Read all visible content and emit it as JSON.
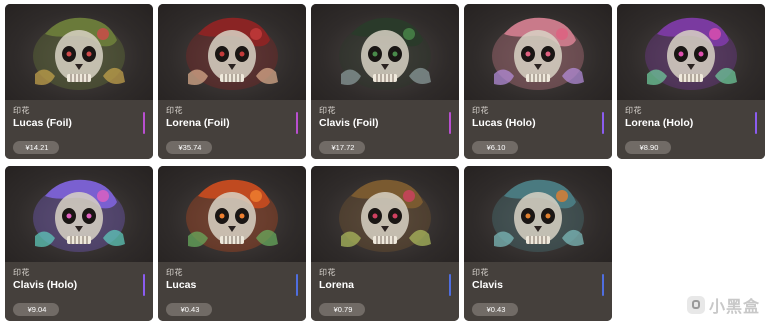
{
  "cards": [
    {
      "type": "印花",
      "name": "Lucas (Foil)",
      "price": "¥14.21",
      "rarity_color": "#b94fd0",
      "art": {
        "base": "#6a7a3a",
        "accent": "#d04a4a",
        "glow": "#c9a64d"
      }
    },
    {
      "type": "印花",
      "name": "Lorena (Foil)",
      "price": "¥35.74",
      "rarity_color": "#b94fd0",
      "art": {
        "base": "#8a2424",
        "accent": "#c43b3b",
        "glow": "#e0b090"
      }
    },
    {
      "type": "印花",
      "name": "Clavis (Foil)",
      "price": "¥17.72",
      "rarity_color": "#b94fd0",
      "art": {
        "base": "#2a3a2a",
        "accent": "#4a8a4a",
        "glow": "#8fa0a0"
      }
    },
    {
      "type": "印花",
      "name": "Lucas (Holo)",
      "price": "¥6.10",
      "rarity_color": "#8b5cf0",
      "art": {
        "base": "#c97a8a",
        "accent": "#e06080",
        "glow": "#b890e0"
      }
    },
    {
      "type": "印花",
      "name": "Lorena (Holo)",
      "price": "¥8.90",
      "rarity_color": "#8b5cf0",
      "art": {
        "base": "#7a3aa0",
        "accent": "#e050b0",
        "glow": "#70d0a0"
      }
    },
    {
      "type": "印花",
      "name": "Clavis (Holo)",
      "price": "¥9.04",
      "rarity_color": "#8b5cf0",
      "art": {
        "base": "#7a60d0",
        "accent": "#e060c0",
        "glow": "#60d0c0"
      }
    },
    {
      "type": "印花",
      "name": "Lucas",
      "price": "¥0.43",
      "rarity_color": "#4f6ee0",
      "art": {
        "base": "#c04a20",
        "accent": "#f08030",
        "glow": "#6ab060"
      }
    },
    {
      "type": "印花",
      "name": "Lorena",
      "price": "¥0.79",
      "rarity_color": "#4f6ee0",
      "art": {
        "base": "#7a5a30",
        "accent": "#d04060",
        "glow": "#b0c060"
      }
    },
    {
      "type": "印花",
      "name": "Clavis",
      "price": "¥0.43",
      "rarity_color": "#4f6ee0",
      "art": {
        "base": "#4a7a80",
        "accent": "#e08030",
        "glow": "#80c0c0"
      }
    }
  ],
  "watermark": {
    "text": "小黑盒"
  }
}
